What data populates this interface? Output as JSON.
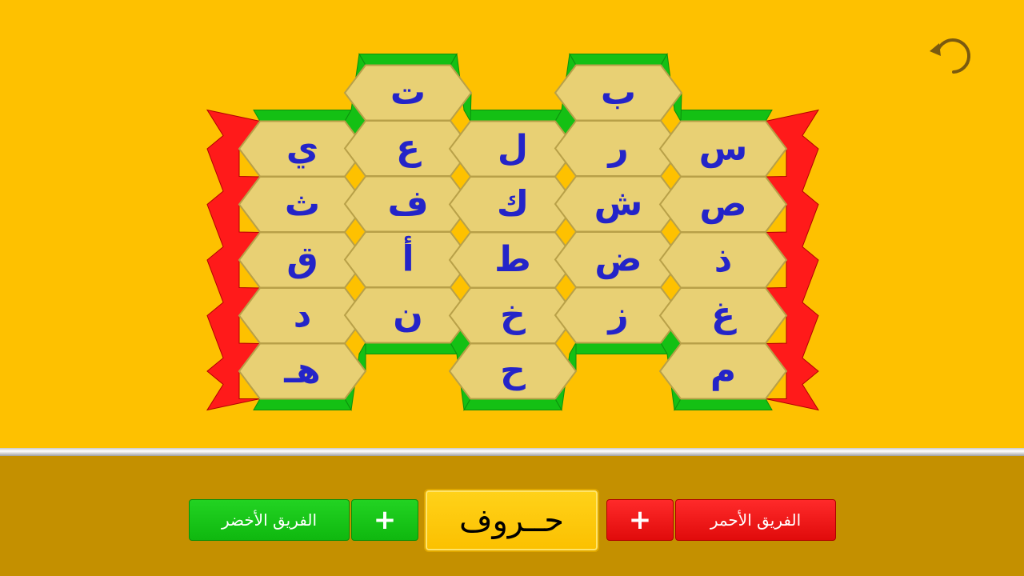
{
  "colors": {
    "background": "#fec100",
    "bottom_bar": "#c49000",
    "cell_fill": "#e8d074",
    "cell_edge": "#b8a048",
    "letter": "#2424c8",
    "green_team": "#14c014",
    "red_team": "#ff1a1a"
  },
  "toolbar": {
    "undo_icon": "undo-arrow-icon"
  },
  "board": {
    "columns": [
      [
        "ي",
        "ث",
        "ق",
        "د",
        "هـ"
      ],
      [
        "ت",
        "ع",
        "ف",
        "أ",
        "ن"
      ],
      [
        "ل",
        "ك",
        "ط",
        "خ",
        "ح"
      ],
      [
        "ب",
        "ر",
        "ش",
        "ض",
        "ز"
      ],
      [
        "س",
        "ص",
        "ذ",
        "غ",
        "م"
      ]
    ]
  },
  "controls": {
    "green_team_label": "الفريق الأخضر",
    "green_plus_label": "+",
    "title": "حــروف",
    "red_plus_label": "+",
    "red_team_label": "الفريق الأحمر"
  }
}
